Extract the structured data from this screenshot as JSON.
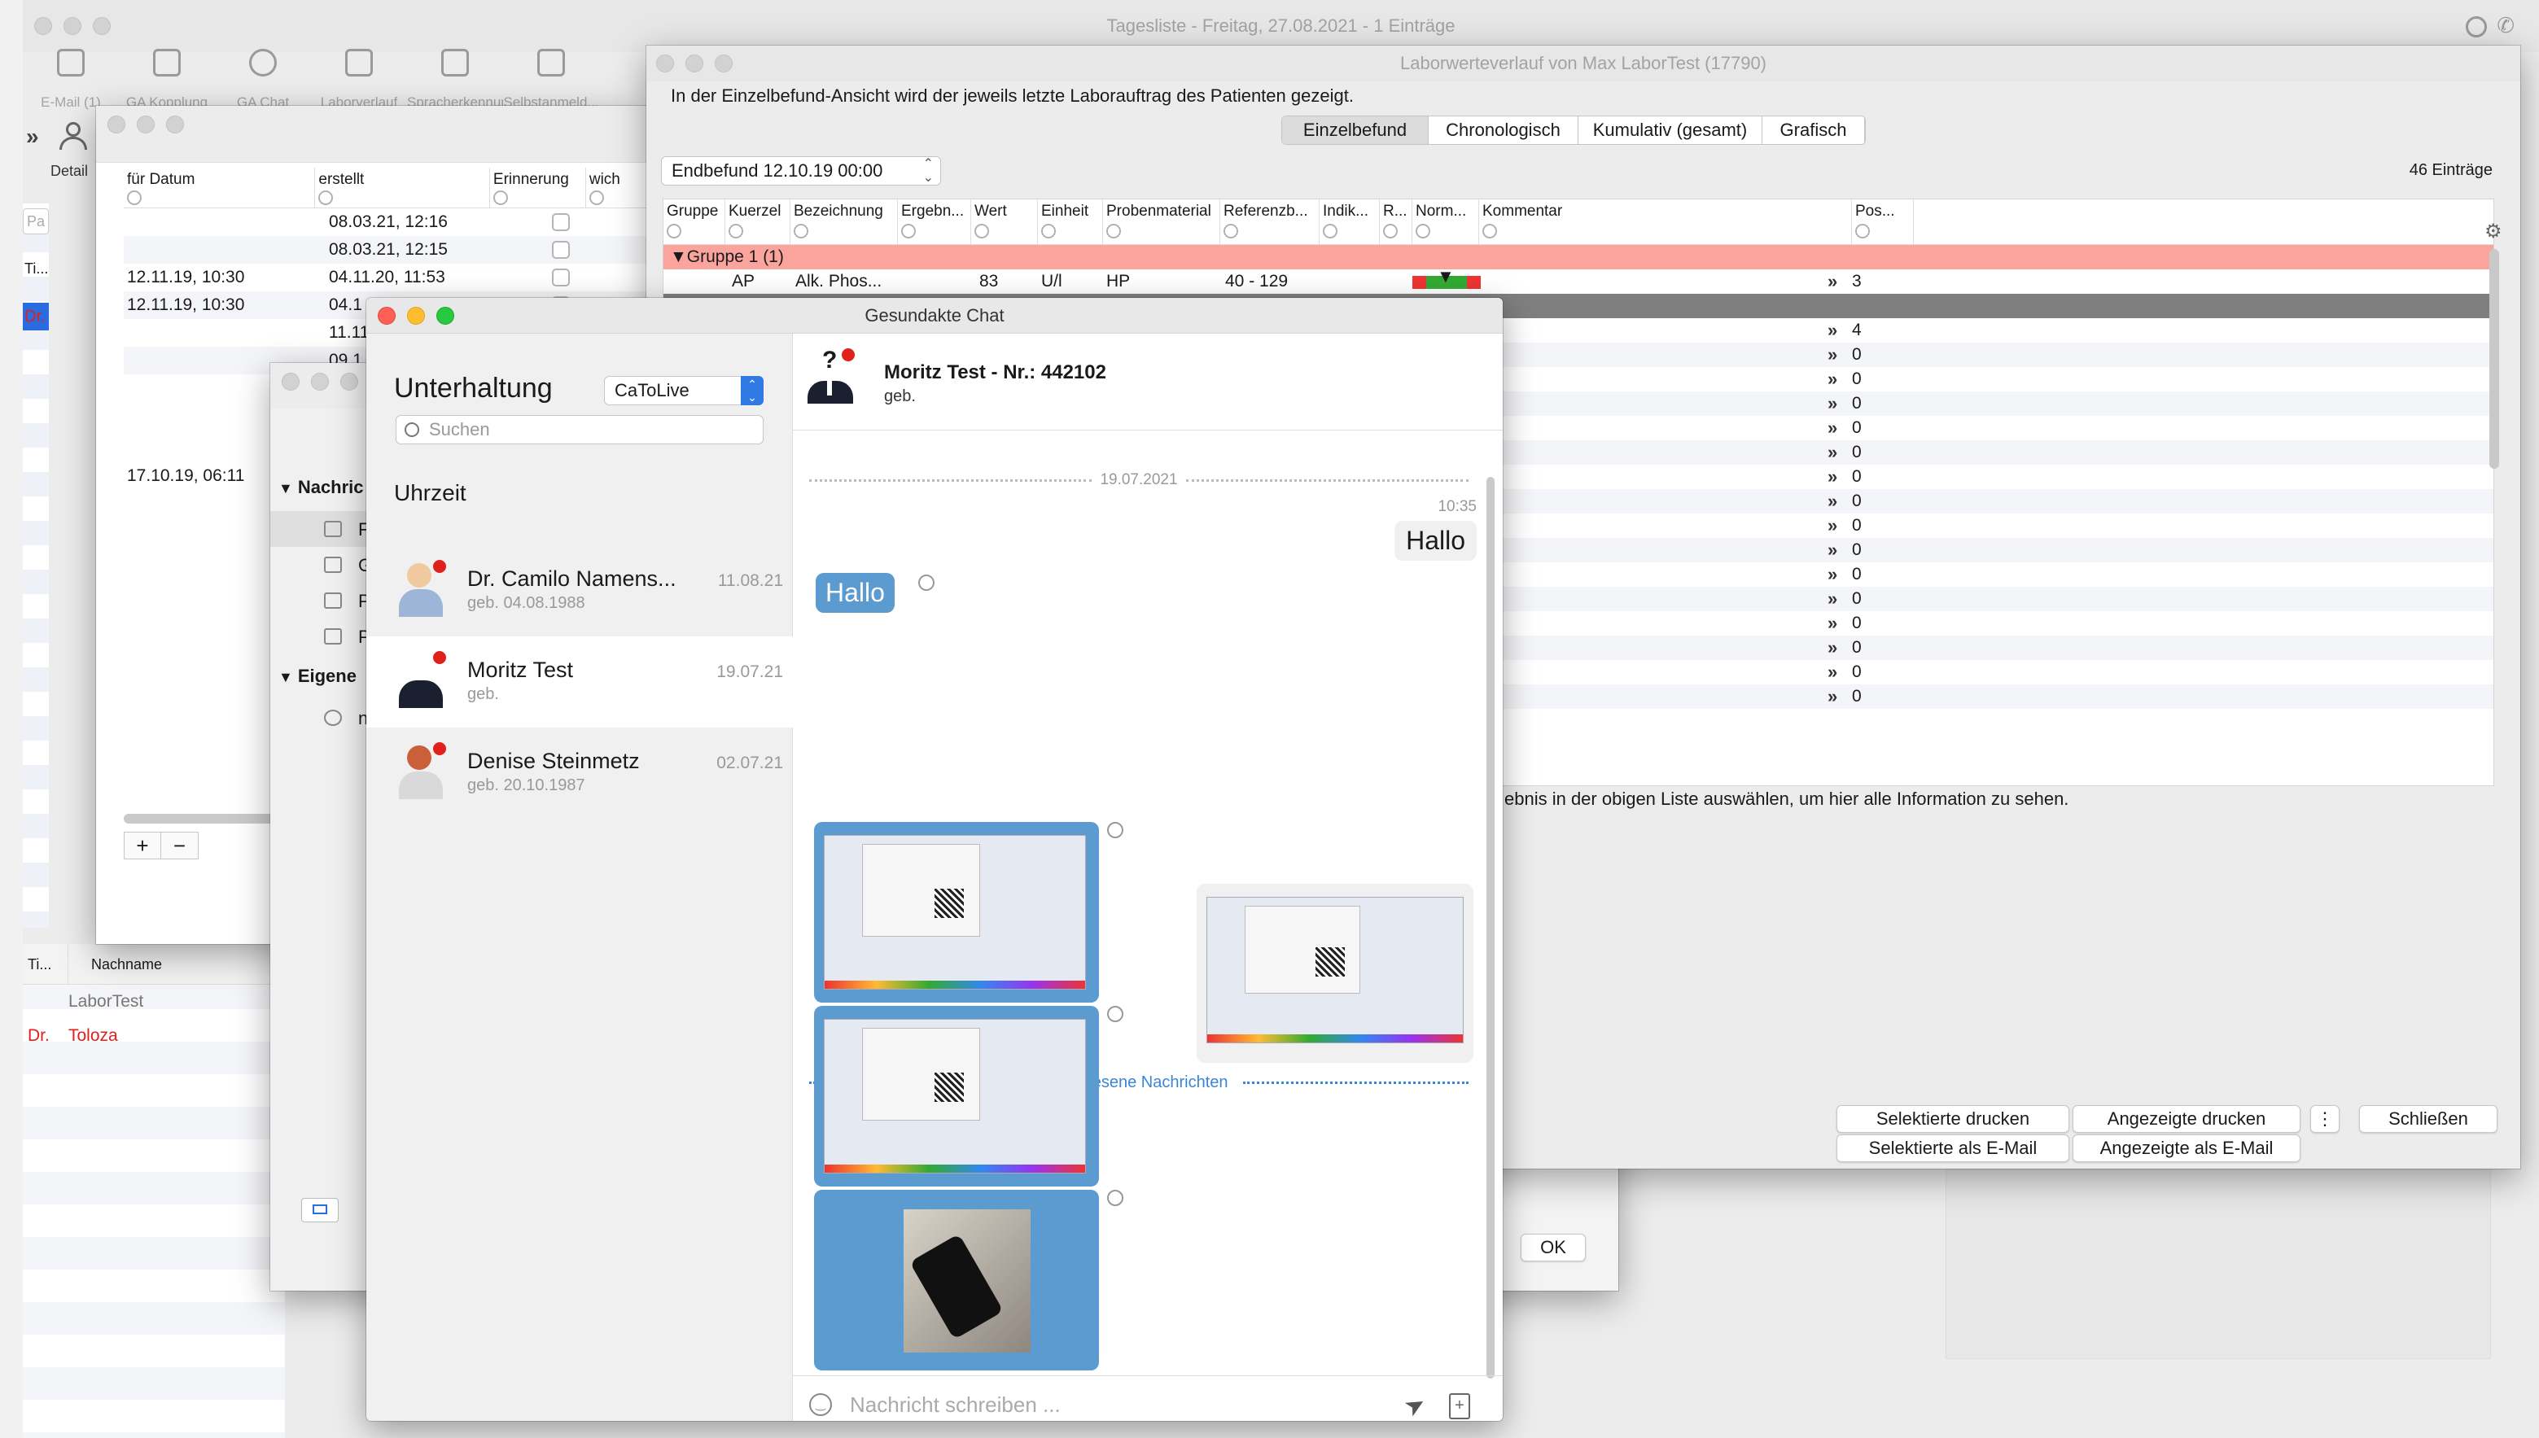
{
  "main_window": {
    "title": "Tagesliste - Freitag, 27.08.2021 - 1 Einträge",
    "toolbar": [
      {
        "label": "E-Mail (1)",
        "icon": "envelope-icon"
      },
      {
        "label": "GA Kopplung",
        "icon": "phone-icon"
      },
      {
        "label": "GA Chat",
        "icon": "chat-bubble-icon"
      },
      {
        "label": "Laborverlauf",
        "icon": "lab-flask-icon"
      },
      {
        "label": "Spracherkennung",
        "icon": "microphone-icon"
      },
      {
        "label": "Selbstanmeld...",
        "icon": "kiosk-icon"
      }
    ],
    "detail_label": "Detail",
    "search_placeholder": "Pa",
    "list_header_ti": "Ti...",
    "list_row_dr": "Dr.",
    "patients_table": {
      "columns": [
        "Ti...",
        "Nachname"
      ],
      "rows": [
        {
          "title": "",
          "name": "LaborTest",
          "highlight": false
        },
        {
          "title": "Dr.",
          "name": "Toloza",
          "highlight": true
        }
      ]
    },
    "colors": {
      "red_text": "#e0201a",
      "selection_blue": "#2a6ce0"
    }
  },
  "reminders_window": {
    "columns": [
      "für Datum",
      "erstellt",
      "Erinnerung",
      "wich"
    ],
    "rows": [
      {
        "date": "",
        "created": "08.03.21, 12:16"
      },
      {
        "date": "",
        "created": "08.03.21, 12:15"
      },
      {
        "date": "12.11.19, 10:30",
        "created": "04.11.20, 11:53"
      },
      {
        "date": "12.11.19, 10:30",
        "created": "04.1"
      },
      {
        "date": "",
        "created": "11.11"
      },
      {
        "date": "",
        "created": "09.1"
      },
      {
        "date": "17.10.19, 06:11",
        "created": ""
      }
    ],
    "add_button": "+",
    "remove_button": "−"
  },
  "messages_window": {
    "sections": [
      {
        "label": "Nachric",
        "items": [
          "F",
          "G",
          "P",
          "P"
        ]
      },
      {
        "label": "Eigene",
        "items": [
          "n"
        ]
      }
    ],
    "ok_button": "OK"
  },
  "lab_window": {
    "title": "Laborwerteverlauf von Max LaborTest (17790)",
    "info": "In der Einzelbefund-Ansicht wird der jeweils letzte Laborauftrag des Patienten gezeigt.",
    "tabs": [
      "Einzelbefund",
      "Chronologisch",
      "Kumulativ (gesamt)",
      "Grafisch"
    ],
    "active_tab": 0,
    "select_value": "Endbefund 12.10.19 00:00",
    "entry_count": "46 Einträge",
    "columns": [
      "Gruppe",
      "Kuerzel",
      "Bezeichnung",
      "Ergebn...",
      "Wert",
      "Einheit",
      "Probenmaterial",
      "Referenzb...",
      "Indik...",
      "R...",
      "Norm...",
      "Kommentar",
      "Pos..."
    ],
    "group_label": "Gruppe 1 (1)",
    "first_row": {
      "kuerzel": "AP",
      "bezeichnung": "Alk. Phos...",
      "wert": "83",
      "einheit": "U/l",
      "probe": "HP",
      "referenz": "40 - 129",
      "pos": "3"
    },
    "positions": [
      "4",
      "0",
      "0",
      "0",
      "0",
      "0",
      "0",
      "0",
      "0",
      "0",
      "0",
      "0",
      "0",
      "0",
      "0",
      "0"
    ],
    "detail_hint": "ebnis in der obigen Liste auswählen, um hier alle Information zu sehen.",
    "buttons": {
      "print_selected": "Selektierte drucken",
      "print_shown": "Angezeigte drucken",
      "more": "⋮",
      "close": "Schließen",
      "email_selected": "Selektierte als E-Mail",
      "email_shown": "Angezeigte als E-Mail"
    },
    "colors": {
      "group_row": "#fba49d",
      "selected_row": "#7f7f7f"
    }
  },
  "chat_window": {
    "title": "Gesundakte Chat",
    "conversation_heading": "Unterhaltung",
    "account_select": "CaToLive",
    "search_placeholder": "Suchen",
    "sort_label": "Uhrzeit",
    "conversations": [
      {
        "name": "Dr. Camilo Namens...",
        "sub": "geb. 04.08.1988",
        "date": "11.08.21",
        "avatar": "male-doctor-avatar-icon",
        "selected": false
      },
      {
        "name": "Moritz Test",
        "sub": "geb.",
        "date": "19.07.21",
        "avatar": "suit-person-question-avatar-icon",
        "selected": true
      },
      {
        "name": "Denise Steinmetz",
        "sub": "geb. 20.10.1987",
        "date": "02.07.21",
        "avatar": "female-avatar-icon",
        "selected": false
      }
    ],
    "contact": {
      "name": "Moritz Test - Nr.: 442102",
      "sub": "geb."
    },
    "date_separator": "19.07.2021",
    "time_label": "10:35",
    "outgoing_message": "Hallo",
    "incoming_message": "Hallo",
    "unread_label": "Ungelesene Nachrichten",
    "input_placeholder": "Nachricht schreiben ...",
    "colors": {
      "bubble_blue": "#5b9bd0",
      "unread_blue": "#3a86d6"
    }
  }
}
